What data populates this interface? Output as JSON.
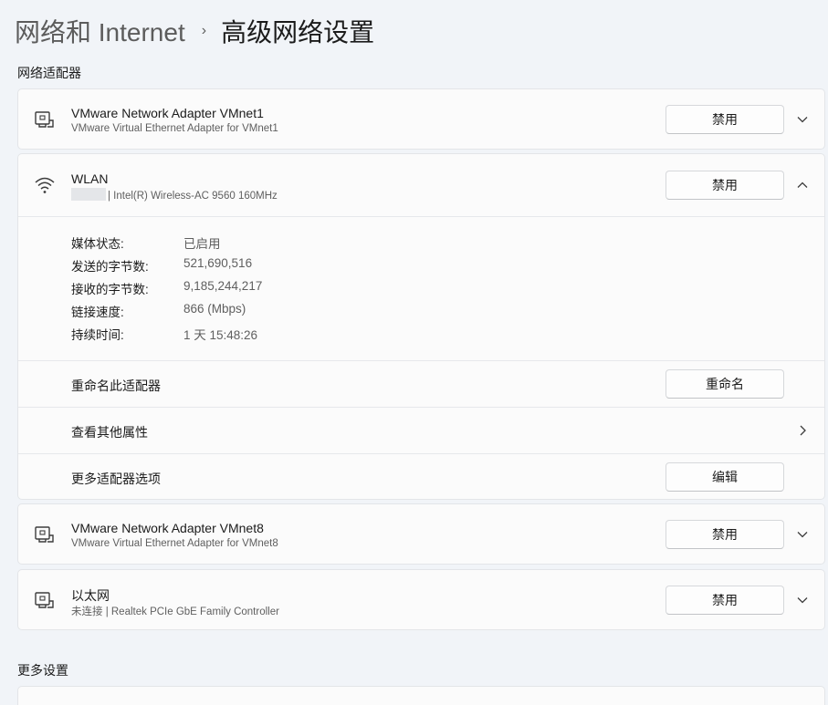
{
  "breadcrumb": {
    "parent": "网络和 Internet",
    "separator": "›",
    "current": "高级网络设置"
  },
  "sections": {
    "adapters_title": "网络适配器",
    "more_settings_title": "更多设置"
  },
  "adapters": [
    {
      "title": "VMware Network Adapter VMnet1",
      "subtitle": "VMware Virtual Ethernet Adapter for VMnet1",
      "button": "禁用",
      "icon": "ethernet-icon",
      "expanded": false
    },
    {
      "title": "WLAN",
      "subtitle": "| Intel(R) Wireless-AC 9560 160MHz",
      "button": "禁用",
      "icon": "wifi-icon",
      "expanded": true
    },
    {
      "title": "VMware Network Adapter VMnet8",
      "subtitle": "VMware Virtual Ethernet Adapter for VMnet8",
      "button": "禁用",
      "icon": "ethernet-icon",
      "expanded": false
    },
    {
      "title": "以太网",
      "subtitle": "未连接 | Realtek PCIe GbE Family Controller",
      "button": "禁用",
      "icon": "ethernet-icon",
      "expanded": false
    }
  ],
  "wlan_details": [
    {
      "label": "媒体状态:",
      "value": "已启用"
    },
    {
      "label": "发送的字节数:",
      "value": "521,690,516"
    },
    {
      "label": "接收的字节数:",
      "value": "9,185,244,217"
    },
    {
      "label": "链接速度:",
      "value": "866 (Mbps)"
    },
    {
      "label": "持续时间:",
      "value": "1 天 15:48:26"
    }
  ],
  "wlan_actions": {
    "rename": {
      "label": "重命名此适配器",
      "button": "重命名"
    },
    "properties": {
      "label": "查看其他属性"
    },
    "more_options": {
      "label": "更多适配器选项",
      "button": "编辑"
    }
  }
}
